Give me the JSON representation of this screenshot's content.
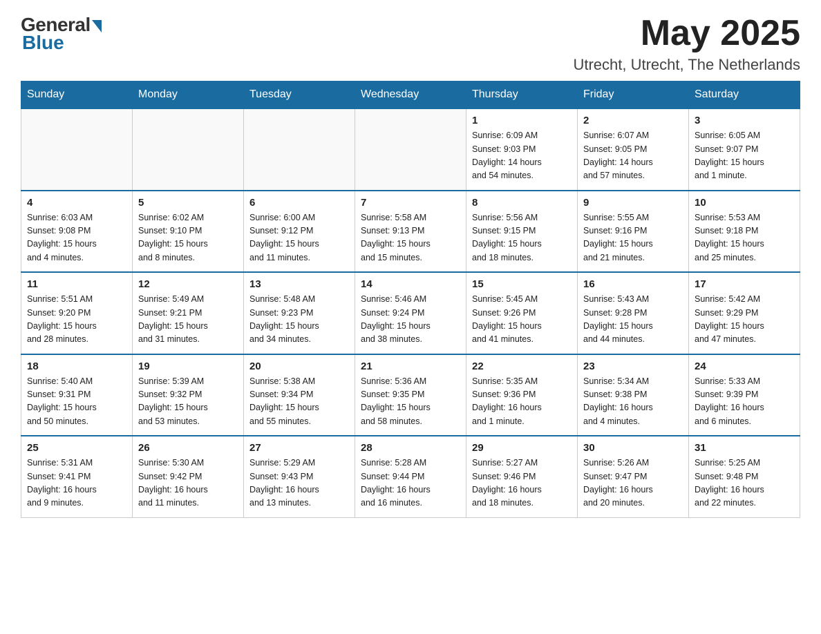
{
  "header": {
    "logo_general": "General",
    "logo_blue": "Blue",
    "month_title": "May 2025",
    "location": "Utrecht, Utrecht, The Netherlands"
  },
  "weekdays": [
    "Sunday",
    "Monday",
    "Tuesday",
    "Wednesday",
    "Thursday",
    "Friday",
    "Saturday"
  ],
  "weeks": [
    [
      {
        "day": "",
        "info": ""
      },
      {
        "day": "",
        "info": ""
      },
      {
        "day": "",
        "info": ""
      },
      {
        "day": "",
        "info": ""
      },
      {
        "day": "1",
        "info": "Sunrise: 6:09 AM\nSunset: 9:03 PM\nDaylight: 14 hours\nand 54 minutes."
      },
      {
        "day": "2",
        "info": "Sunrise: 6:07 AM\nSunset: 9:05 PM\nDaylight: 14 hours\nand 57 minutes."
      },
      {
        "day": "3",
        "info": "Sunrise: 6:05 AM\nSunset: 9:07 PM\nDaylight: 15 hours\nand 1 minute."
      }
    ],
    [
      {
        "day": "4",
        "info": "Sunrise: 6:03 AM\nSunset: 9:08 PM\nDaylight: 15 hours\nand 4 minutes."
      },
      {
        "day": "5",
        "info": "Sunrise: 6:02 AM\nSunset: 9:10 PM\nDaylight: 15 hours\nand 8 minutes."
      },
      {
        "day": "6",
        "info": "Sunrise: 6:00 AM\nSunset: 9:12 PM\nDaylight: 15 hours\nand 11 minutes."
      },
      {
        "day": "7",
        "info": "Sunrise: 5:58 AM\nSunset: 9:13 PM\nDaylight: 15 hours\nand 15 minutes."
      },
      {
        "day": "8",
        "info": "Sunrise: 5:56 AM\nSunset: 9:15 PM\nDaylight: 15 hours\nand 18 minutes."
      },
      {
        "day": "9",
        "info": "Sunrise: 5:55 AM\nSunset: 9:16 PM\nDaylight: 15 hours\nand 21 minutes."
      },
      {
        "day": "10",
        "info": "Sunrise: 5:53 AM\nSunset: 9:18 PM\nDaylight: 15 hours\nand 25 minutes."
      }
    ],
    [
      {
        "day": "11",
        "info": "Sunrise: 5:51 AM\nSunset: 9:20 PM\nDaylight: 15 hours\nand 28 minutes."
      },
      {
        "day": "12",
        "info": "Sunrise: 5:49 AM\nSunset: 9:21 PM\nDaylight: 15 hours\nand 31 minutes."
      },
      {
        "day": "13",
        "info": "Sunrise: 5:48 AM\nSunset: 9:23 PM\nDaylight: 15 hours\nand 34 minutes."
      },
      {
        "day": "14",
        "info": "Sunrise: 5:46 AM\nSunset: 9:24 PM\nDaylight: 15 hours\nand 38 minutes."
      },
      {
        "day": "15",
        "info": "Sunrise: 5:45 AM\nSunset: 9:26 PM\nDaylight: 15 hours\nand 41 minutes."
      },
      {
        "day": "16",
        "info": "Sunrise: 5:43 AM\nSunset: 9:28 PM\nDaylight: 15 hours\nand 44 minutes."
      },
      {
        "day": "17",
        "info": "Sunrise: 5:42 AM\nSunset: 9:29 PM\nDaylight: 15 hours\nand 47 minutes."
      }
    ],
    [
      {
        "day": "18",
        "info": "Sunrise: 5:40 AM\nSunset: 9:31 PM\nDaylight: 15 hours\nand 50 minutes."
      },
      {
        "day": "19",
        "info": "Sunrise: 5:39 AM\nSunset: 9:32 PM\nDaylight: 15 hours\nand 53 minutes."
      },
      {
        "day": "20",
        "info": "Sunrise: 5:38 AM\nSunset: 9:34 PM\nDaylight: 15 hours\nand 55 minutes."
      },
      {
        "day": "21",
        "info": "Sunrise: 5:36 AM\nSunset: 9:35 PM\nDaylight: 15 hours\nand 58 minutes."
      },
      {
        "day": "22",
        "info": "Sunrise: 5:35 AM\nSunset: 9:36 PM\nDaylight: 16 hours\nand 1 minute."
      },
      {
        "day": "23",
        "info": "Sunrise: 5:34 AM\nSunset: 9:38 PM\nDaylight: 16 hours\nand 4 minutes."
      },
      {
        "day": "24",
        "info": "Sunrise: 5:33 AM\nSunset: 9:39 PM\nDaylight: 16 hours\nand 6 minutes."
      }
    ],
    [
      {
        "day": "25",
        "info": "Sunrise: 5:31 AM\nSunset: 9:41 PM\nDaylight: 16 hours\nand 9 minutes."
      },
      {
        "day": "26",
        "info": "Sunrise: 5:30 AM\nSunset: 9:42 PM\nDaylight: 16 hours\nand 11 minutes."
      },
      {
        "day": "27",
        "info": "Sunrise: 5:29 AM\nSunset: 9:43 PM\nDaylight: 16 hours\nand 13 minutes."
      },
      {
        "day": "28",
        "info": "Sunrise: 5:28 AM\nSunset: 9:44 PM\nDaylight: 16 hours\nand 16 minutes."
      },
      {
        "day": "29",
        "info": "Sunrise: 5:27 AM\nSunset: 9:46 PM\nDaylight: 16 hours\nand 18 minutes."
      },
      {
        "day": "30",
        "info": "Sunrise: 5:26 AM\nSunset: 9:47 PM\nDaylight: 16 hours\nand 20 minutes."
      },
      {
        "day": "31",
        "info": "Sunrise: 5:25 AM\nSunset: 9:48 PM\nDaylight: 16 hours\nand 22 minutes."
      }
    ]
  ]
}
